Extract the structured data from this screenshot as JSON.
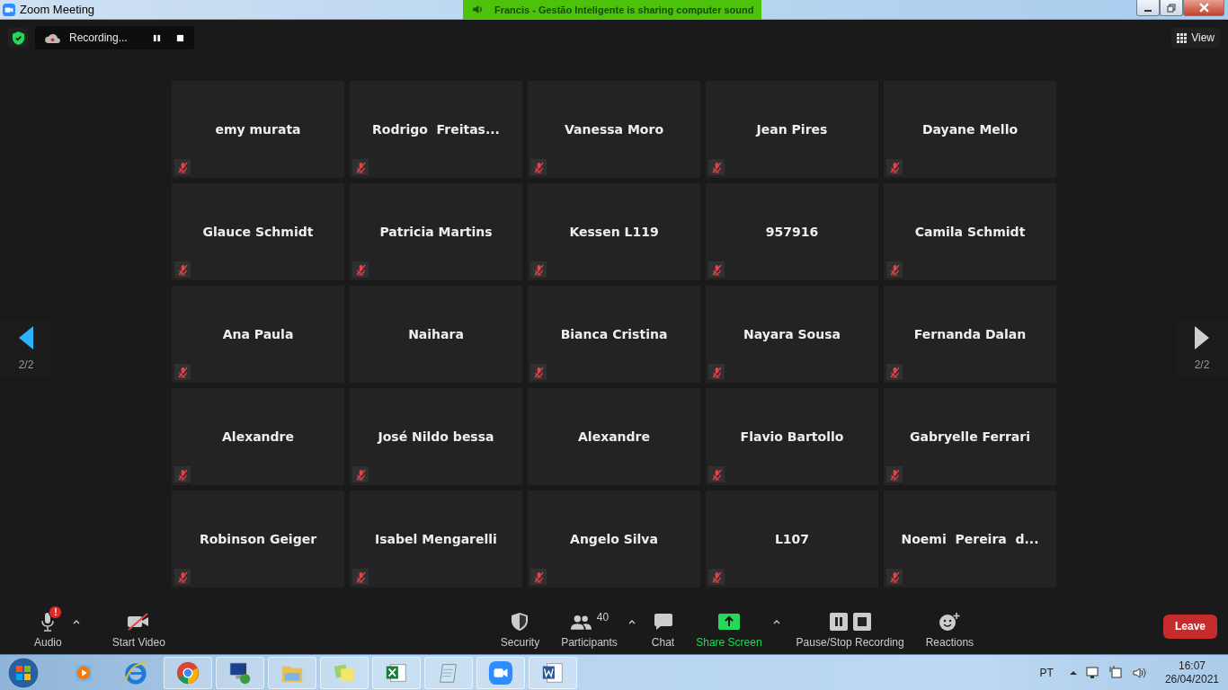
{
  "window": {
    "title": "Zoom Meeting"
  },
  "share_banner": "Francis - Gestão Inteligente is sharing computer sound",
  "recording": {
    "label": "Recording..."
  },
  "view_button": "View",
  "pager": {
    "left": "2/2",
    "right": "2/2"
  },
  "tiles": [
    {
      "name": "emy murata",
      "muted": true
    },
    {
      "name": "Rodrigo  Freitas...",
      "muted": true
    },
    {
      "name": "Vanessa Moro",
      "muted": true
    },
    {
      "name": "Jean Pires",
      "muted": true
    },
    {
      "name": "Dayane Mello",
      "muted": true
    },
    {
      "name": "Glauce Schmidt",
      "muted": true
    },
    {
      "name": "Patricia Martins",
      "muted": true
    },
    {
      "name": "Kessen L119",
      "muted": true
    },
    {
      "name": "957916",
      "muted": true
    },
    {
      "name": "Camila Schmidt",
      "muted": true
    },
    {
      "name": "Ana Paula",
      "muted": true
    },
    {
      "name": "Naihara",
      "muted": false
    },
    {
      "name": "Bianca Cristina",
      "muted": true
    },
    {
      "name": "Nayara Sousa",
      "muted": true
    },
    {
      "name": "Fernanda Dalan",
      "muted": true
    },
    {
      "name": "Alexandre",
      "muted": true
    },
    {
      "name": "José Nildo bessa",
      "muted": true
    },
    {
      "name": "Alexandre",
      "muted": false
    },
    {
      "name": "Flavio Bartollo",
      "muted": true
    },
    {
      "name": "Gabryelle Ferrari",
      "muted": true
    },
    {
      "name": "Robinson Geiger",
      "muted": true
    },
    {
      "name": "Isabel Mengarelli",
      "muted": true
    },
    {
      "name": "Angelo Silva",
      "muted": true
    },
    {
      "name": "L107",
      "muted": true
    },
    {
      "name": "Noemi  Pereira  d...",
      "muted": true
    }
  ],
  "toolbar_left": [
    {
      "kind": "audio",
      "label": "Audio",
      "badge": "!",
      "caret": true
    },
    {
      "kind": "video",
      "label": "Start Video",
      "caret": false
    }
  ],
  "toolbar_center": [
    {
      "kind": "security",
      "label": "Security",
      "caret": false
    },
    {
      "kind": "participants",
      "label": "Participants",
      "count": "40",
      "caret": true
    },
    {
      "kind": "chat",
      "label": "Chat",
      "caret": false
    },
    {
      "kind": "share",
      "label": "Share Screen",
      "caret": true
    },
    {
      "kind": "recording",
      "label": "Pause/Stop Recording",
      "caret": false
    },
    {
      "kind": "reactions",
      "label": "Reactions",
      "caret": false
    }
  ],
  "leave_button": "Leave",
  "tray": {
    "language": "PT",
    "time": "16:07",
    "date": "26/04/2021"
  }
}
